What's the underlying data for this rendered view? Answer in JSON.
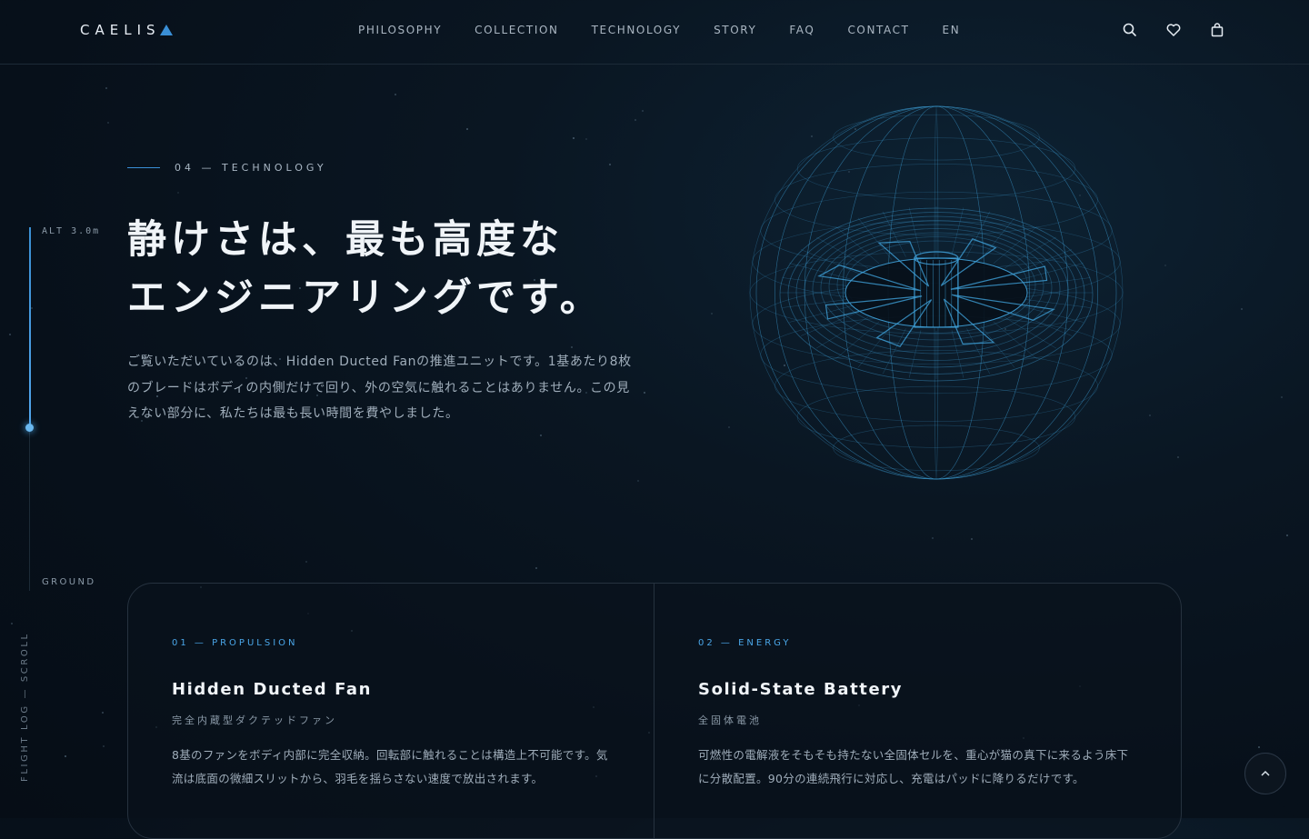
{
  "header": {
    "logo": "CAELIS",
    "nav": [
      {
        "label": "PHILOSOPHY"
      },
      {
        "label": "COLLECTION"
      },
      {
        "label": "TECHNOLOGY"
      },
      {
        "label": "STORY"
      },
      {
        "label": "FAQ"
      },
      {
        "label": "CONTACT"
      },
      {
        "label": "EN"
      }
    ],
    "icons": [
      "search-icon",
      "heart-icon",
      "bag-icon"
    ]
  },
  "rail": {
    "altitude": "ALT 3.0m",
    "ground": "GROUND",
    "vertical": "FLIGHT LOG — SCROLL",
    "progress": 0.55
  },
  "hero": {
    "eyebrow": "04 — TECHNOLOGY",
    "title_line1": "静けさは、最も高度な",
    "title_line2": "エンジニアリングです。",
    "lead": "ご覧いただいているのは、Hidden Ducted Fanの推進ユニットです。1基あたり8枚のブレードはボディの内側だけで回り、外の空気に触れることはありません。この見えない部分に、私たちは最も長い時間を費やしました。"
  },
  "features": [
    {
      "eyebrow": "01 — PROPULSION",
      "title": "Hidden Ducted Fan",
      "subtitle": "完全内蔵型ダクテッドファン",
      "body": "8基のファンをボディ内部に完全収納。回転部に触れることは構造上不可能です。気流は底面の微細スリットから、羽毛を揺らさない速度で放出されます。"
    },
    {
      "eyebrow": "02 — ENERGY",
      "title": "Solid-State Battery",
      "subtitle": "全固体電池",
      "body": "可燃性の電解液をそもそも持たない全固体セルを、重心が猫の真下に来るよう床下に分散配置。90分の連続飛行に対応し、充電はパッドに降りるだけです。"
    }
  ],
  "colors": {
    "accent": "#3a8fd6",
    "background": "#07101a",
    "wire": "#3fa0d8"
  }
}
